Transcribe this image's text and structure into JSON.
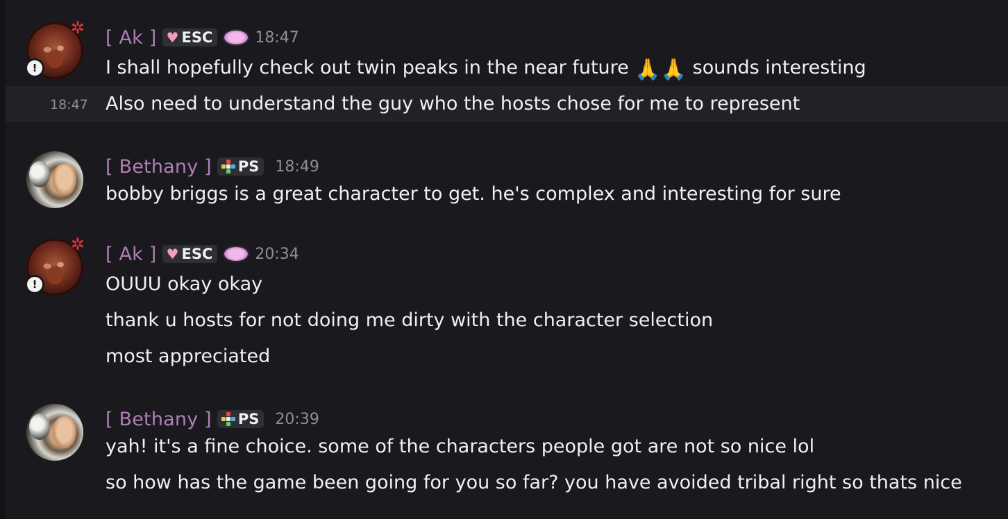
{
  "messages": [
    {
      "author": "[ Ak ]",
      "tag": "ESC",
      "timestamp": "18:47",
      "lines": [
        {
          "before": "I shall hopefully check out twin peaks in the near future ",
          "emoji": "🙏🙏",
          "after": " sounds interesting"
        },
        {
          "text": "Also need to understand the guy who the hosts chose for me to represent",
          "hover_time": "18:47"
        }
      ]
    },
    {
      "author": "[ Bethany ]",
      "tag": "PS",
      "timestamp": "18:49",
      "lines": [
        {
          "text": "bobby briggs is a great character to get. he's complex and interesting for sure"
        }
      ]
    },
    {
      "author": "[ Ak ]",
      "tag": "ESC",
      "timestamp": "20:34",
      "lines": [
        {
          "text": "OUUU okay okay"
        },
        {
          "text": "thank u hosts for not doing me dirty with the character selection"
        },
        {
          "text": "most appreciated"
        }
      ]
    },
    {
      "author": "[ Bethany ]",
      "tag": "PS",
      "timestamp": "20:39",
      "lines": [
        {
          "text": "yah! it's a fine choice. some of the characters people got are not so nice lol"
        },
        {
          "text": "so how has the game been going for you so far? you have avoided tribal right so thats nice"
        }
      ]
    }
  ],
  "icons": {
    "ak_tag_icon": "heart-icon",
    "beth_tag_icon": "diamond-arrows-icon",
    "ak_server_icon": "server-emblem-icon",
    "ak_status": "warning-icon",
    "ak_decoration": "anger-mark-icon"
  },
  "colors": {
    "background": "#1a1a1e",
    "username": "#b07eb6",
    "message_text": "#f0f1f3",
    "timestamp": "#8d8f97",
    "tag_background": "#2e2e35"
  }
}
